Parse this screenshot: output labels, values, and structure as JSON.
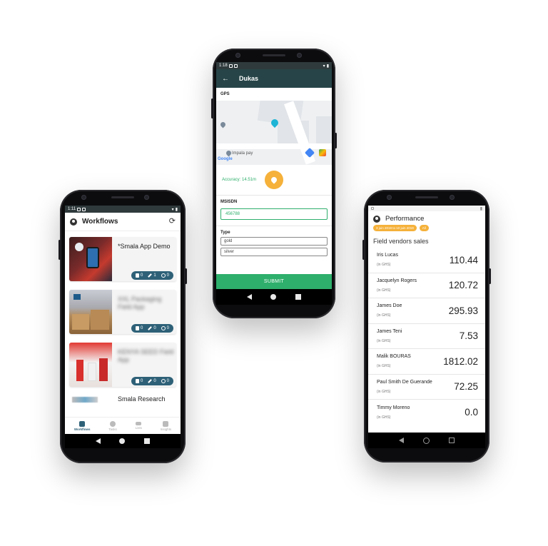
{
  "phone_workflows": {
    "status_time": "1:11",
    "header_title": "Workflows",
    "workflows": [
      {
        "name": "*Smala App Demo",
        "forms": "0",
        "edits": "1",
        "pending": "0",
        "blurred": false
      },
      {
        "name": "XXL Packaging Field App",
        "forms": "0",
        "edits": "0",
        "pending": "0",
        "blurred": true
      },
      {
        "name": "KENYA SEED Field App",
        "forms": "0",
        "edits": "0",
        "pending": "0",
        "blurred": true
      }
    ],
    "partial_item": "Smala Research",
    "tabs": [
      "Workflows",
      "Tasks",
      "Lists",
      "Insights"
    ]
  },
  "phone_form": {
    "status_time": "1:18",
    "title": "Dukas",
    "gps_label": "GPS",
    "map_place": "Impala pay",
    "map_brand": "Google",
    "accuracy": "Accuracy: 14.51m",
    "msisdn_label": "MSISDN",
    "msisdn_value": "456788",
    "type_label": "Type",
    "type_options": [
      "gold",
      "silver"
    ],
    "submit_label": "SUBMIT"
  },
  "phone_performance": {
    "title": "Performance",
    "date_chip": "3 juin 2019 to 10 juin 2019",
    "scope_chip": "All",
    "section_title": "Field vendors sales",
    "unit": "(in GHS)",
    "vendors": [
      {
        "name": "Iris Lucas",
        "value": "110.44"
      },
      {
        "name": "Jacquelyn Rogers",
        "value": "120.72"
      },
      {
        "name": "James Doe",
        "value": "295.93"
      },
      {
        "name": "James Teni",
        "value": "7.53"
      },
      {
        "name": "Malik BOURAS",
        "value": "1812.02"
      },
      {
        "name": "Paul Smith De Guerande",
        "value": "72.25"
      },
      {
        "name": "Timmy Moreno",
        "value": "0.0"
      }
    ]
  },
  "colors": {
    "accent_green": "#2eaf6b",
    "accent_teal": "#2e6178",
    "accent_orange": "#f5b13a",
    "header_dark": "#274548"
  }
}
